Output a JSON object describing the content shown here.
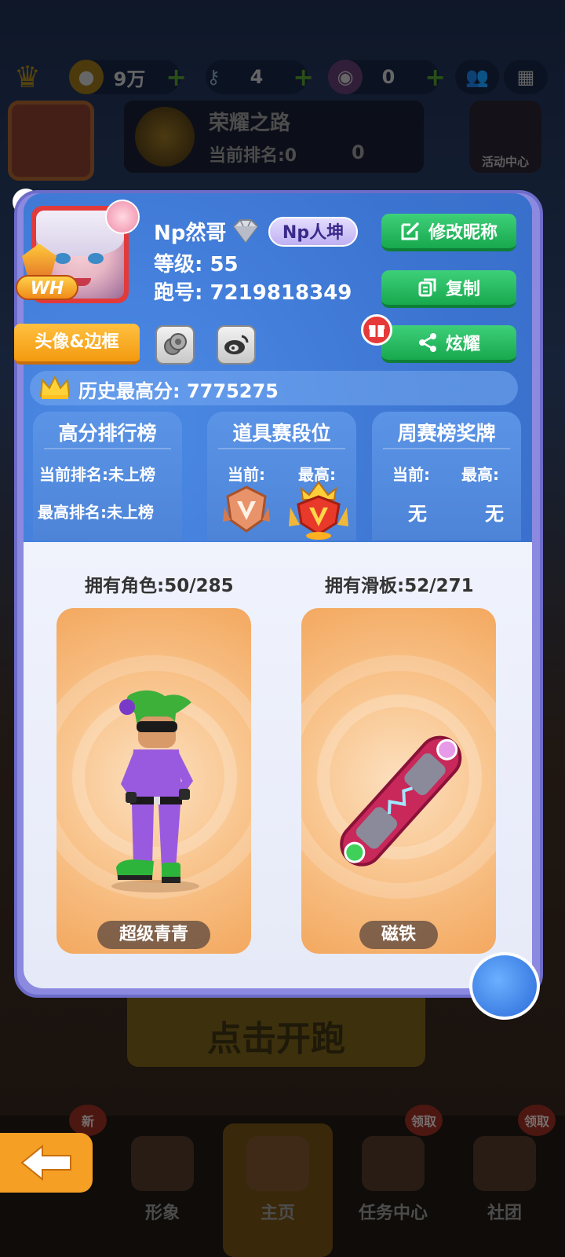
{
  "background": {
    "resources": [
      {
        "icon": "coin-icon",
        "value": "9万"
      },
      {
        "icon": "key-icon",
        "value": "4"
      },
      {
        "icon": "token-icon",
        "value": "0"
      }
    ],
    "glory_road": {
      "title": "荣耀之路",
      "rank_label": "当前排名:0",
      "trophy_count": "0"
    },
    "activity_center": "活动中心",
    "start_button": "点击开跑",
    "tabs": [
      {
        "label": "形象",
        "badge": "新"
      },
      {
        "label": "主页"
      },
      {
        "label": "任务中心",
        "badge": "领取"
      },
      {
        "label": "社团",
        "badge": "领取"
      }
    ]
  },
  "profile": {
    "name": "Np然哥",
    "nickname_tag": "Np人坤",
    "level_label": "等级:",
    "level_value": "55",
    "runid_label": "跑号:",
    "runid_value": "7219818349",
    "avatar_badge": "WH",
    "buttons": {
      "edit_nick": "修改昵称",
      "copy": "复制",
      "share": "炫耀",
      "avatar_frame": "头像&边框"
    },
    "high_score_label": "历史最高分:",
    "high_score_value": "7775275"
  },
  "cards": {
    "score_board": {
      "title": "高分排行榜",
      "current": "当前排名:未上榜",
      "best": "最高排名:未上榜"
    },
    "item_rank": {
      "title": "道具赛段位",
      "current_label": "当前:",
      "best_label": "最高:"
    },
    "weekly_medal": {
      "title": "周赛榜奖牌",
      "current_label": "当前:",
      "best_label": "最高:",
      "current_value": "无",
      "best_value": "无"
    }
  },
  "collection": {
    "characters_label": "拥有角色:50/285",
    "boards_label": "拥有滑板:52/271",
    "character_name": "超级青青",
    "board_name": "磁铁"
  },
  "colors": {
    "panel_blue": "#3f7ad6",
    "green_button": "#18a84e",
    "orange_button": "#f39a10"
  }
}
